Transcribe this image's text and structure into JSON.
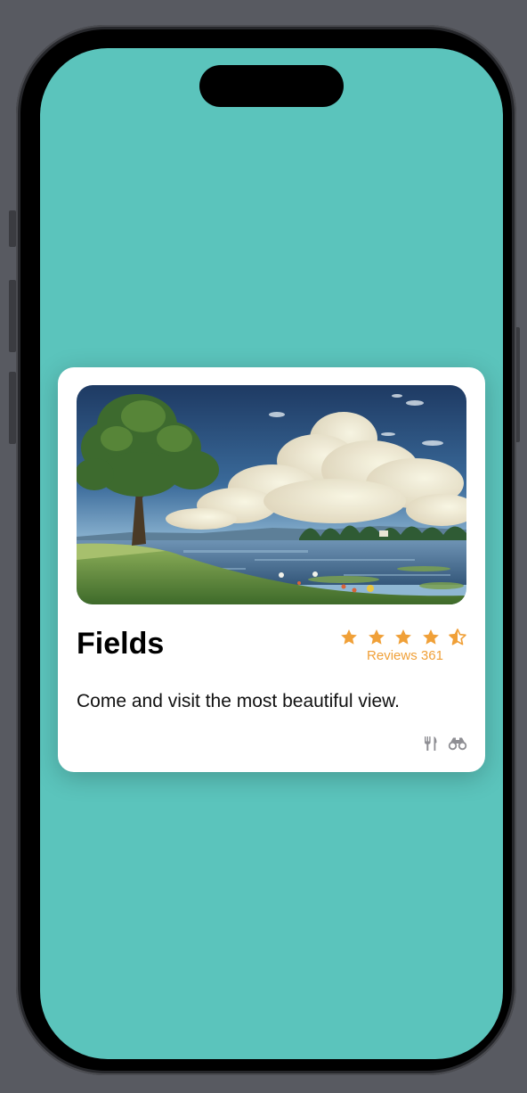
{
  "card": {
    "title": "Fields",
    "description": "Come and visit the most beautiful view.",
    "rating": {
      "value": 4.5,
      "max": 5,
      "reviews_label": "Reviews 361"
    },
    "image_alt": "Landscape with a tree, lake and clouds",
    "amenities": [
      "fork-knife-icon",
      "binoculars-icon"
    ]
  },
  "colors": {
    "screen_background": "#5bc4bc",
    "card_background": "#ffffff",
    "accent": "#f0a038",
    "icon": "#8e8e93"
  }
}
